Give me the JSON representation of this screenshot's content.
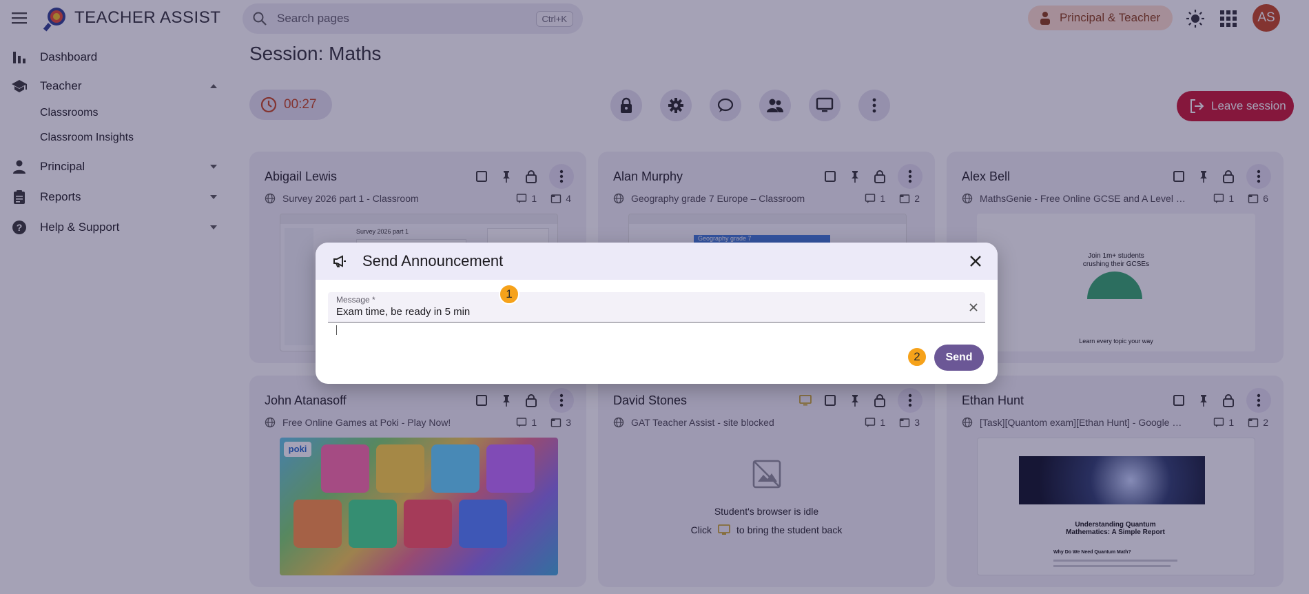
{
  "app": {
    "title": "TEACHER ASSIST"
  },
  "search": {
    "placeholder": "Search pages",
    "shortcut": "Ctrl+K"
  },
  "header": {
    "role_label": "Principal & Teacher",
    "avatar_initials": "AS"
  },
  "sidebar": {
    "items": [
      {
        "label": "Dashboard",
        "icon": "bar-chart-icon"
      },
      {
        "label": "Teacher",
        "icon": "school-icon",
        "expanded": true
      },
      {
        "label": "Principal",
        "icon": "person-icon"
      },
      {
        "label": "Reports",
        "icon": "clipboard-icon"
      },
      {
        "label": "Help & Support",
        "icon": "help-icon"
      }
    ],
    "teacher_sub": [
      "Classrooms",
      "Classroom Insights"
    ]
  },
  "session": {
    "title": "Session: Maths",
    "timer": "00:27",
    "leave_label": "Leave session"
  },
  "students": [
    {
      "name": "Abigail Lewis",
      "url": "Survey 2026 part 1 - Classroom",
      "messages": "1",
      "tabs": "4"
    },
    {
      "name": "Alan Murphy",
      "url": "Geography grade 7 Europe – Classroom",
      "messages": "1",
      "tabs": "2"
    },
    {
      "name": "Alex Bell",
      "url": "MathsGenie - Free Online GCSE and A Level Ma...",
      "messages": "1",
      "tabs": "6"
    },
    {
      "name": "John Atanasoff",
      "url": "Free Online Games at Poki - Play Now!",
      "messages": "1",
      "tabs": "3"
    },
    {
      "name": "David Stones",
      "url": "GAT Teacher Assist - site blocked",
      "messages": "1",
      "tabs": "3"
    },
    {
      "name": "Ethan Hunt",
      "url": "[Task][Quantom exam][Ethan Hunt] - Google D...",
      "messages": "1",
      "tabs": "2"
    }
  ],
  "thumbs": {
    "abigail_title": "Survey 2026 part 1",
    "alan_title": "Geography grade 7",
    "alex_line1": "Join 1m+ students",
    "alex_line2": "crushing their GCSEs",
    "alex_footer": "Learn every topic your way",
    "poki_logo": "poki",
    "ethan_heading": "Understanding Quantum Mathematics: A Simple Report",
    "ethan_sub": "Why Do We Need Quantum Math?"
  },
  "idle": {
    "message": "Student's browser is idle",
    "hint_before": "Click",
    "hint_after": "to bring the student back"
  },
  "dialog": {
    "title": "Send Announcement",
    "field_label": "Message *",
    "field_value": "Exam time, be ready in 5 min",
    "send_label": "Send",
    "steps": [
      "1",
      "2"
    ]
  },
  "colors": {
    "accent": "#6b5796",
    "danger": "#c8102e",
    "step": "#f6a21a",
    "avatar": "#c4421a"
  }
}
